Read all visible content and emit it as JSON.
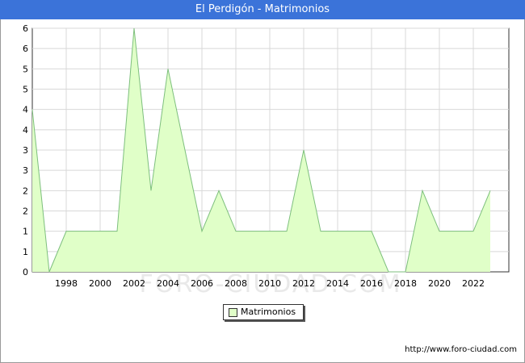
{
  "title": "El Perdigón - Matrimonios",
  "watermark": "FORO-CIUDAD.COM",
  "source_url": "http://www.foro-ciudad.com",
  "legend": {
    "label": "Matrimonios"
  },
  "colors": {
    "title_bar": "#3b73d9",
    "area_fill": "#e0ffc8",
    "line": "#7dbf7d",
    "grid": "#d8d8d8"
  },
  "chart_data": {
    "type": "area",
    "title": "El Perdigón - Matrimonios",
    "xlabel": "",
    "ylabel": "",
    "x": [
      1996,
      1997,
      1998,
      1999,
      2000,
      2001,
      2002,
      2003,
      2004,
      2005,
      2006,
      2007,
      2008,
      2009,
      2010,
      2011,
      2012,
      2013,
      2014,
      2015,
      2016,
      2017,
      2018,
      2019,
      2020,
      2021,
      2022,
      2023
    ],
    "series": [
      {
        "name": "Matrimonios",
        "values": [
          8,
          0,
          2,
          2,
          2,
          2,
          12,
          4,
          10,
          6,
          2,
          4,
          2,
          2,
          2,
          2,
          6,
          2,
          2,
          2,
          2,
          0,
          0,
          4,
          2,
          2,
          2,
          4
        ]
      }
    ],
    "x_ticks": [
      1998,
      2000,
      2002,
      2004,
      2006,
      2008,
      2010,
      2012,
      2014,
      2016,
      2018,
      2020,
      2022
    ],
    "y_ticks": [
      0,
      1,
      1,
      2,
      2,
      3,
      3,
      4,
      4,
      5,
      5,
      6,
      6
    ],
    "ylim": [
      0,
      12
    ],
    "grid": true,
    "legend_position": "bottom-center"
  }
}
